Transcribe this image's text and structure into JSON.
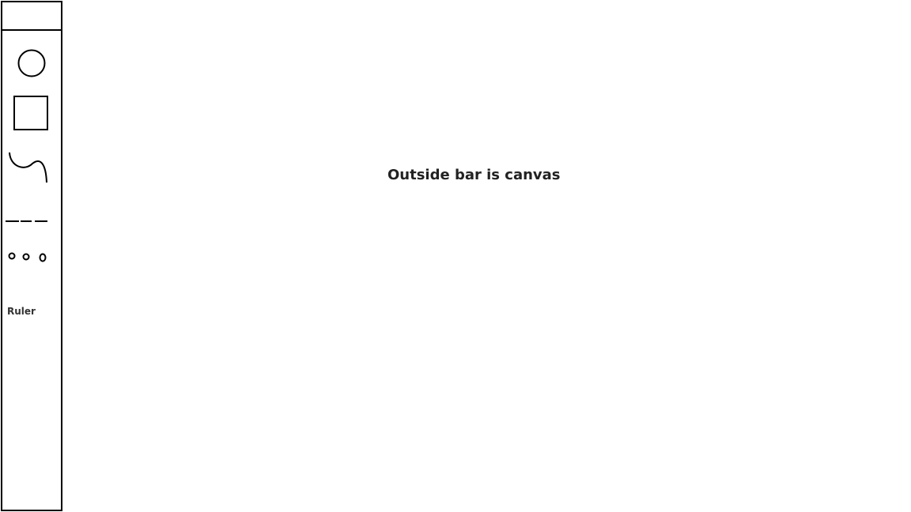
{
  "toolbar": {
    "tools": [
      {
        "name": "circle",
        "icon": "circle-icon"
      },
      {
        "name": "rectangle",
        "icon": "rectangle-icon"
      },
      {
        "name": "curve",
        "icon": "curve-icon"
      },
      {
        "name": "dashed-line",
        "icon": "dashed-line-icon"
      },
      {
        "name": "dotted-line",
        "icon": "dotted-line-icon"
      }
    ],
    "ruler_label": "Ruler"
  },
  "canvas": {
    "label": "Outside bar is canvas"
  },
  "colors": {
    "stroke": "#000000",
    "background": "#ffffff",
    "text": "#222222"
  }
}
